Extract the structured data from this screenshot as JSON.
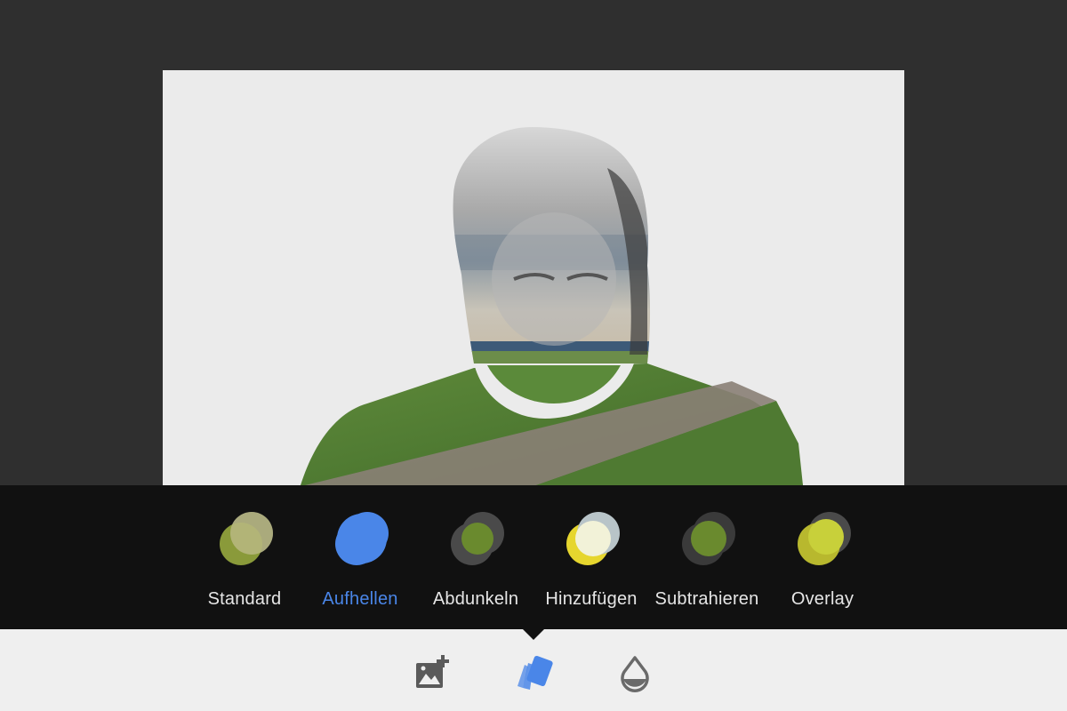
{
  "blend_modes": [
    {
      "label": "Standard",
      "active": false
    },
    {
      "label": "Aufhellen",
      "active": true
    },
    {
      "label": "Abdunkeln",
      "active": false
    },
    {
      "label": "Hinzufügen",
      "active": false
    },
    {
      "label": "Subtrahieren",
      "active": false
    },
    {
      "label": "Overlay",
      "active": false
    }
  ],
  "toolbar": {
    "tools": [
      {
        "icon": "add-image-icon",
        "active": false
      },
      {
        "icon": "blend-modes-icon",
        "active": true
      },
      {
        "icon": "opacity-drop-icon",
        "active": false
      }
    ]
  },
  "colors": {
    "accent": "#4a86e8",
    "panel_bg": "#111111",
    "toolbar_bg": "#efefef",
    "canvas_bg": "#2f2f2f"
  }
}
